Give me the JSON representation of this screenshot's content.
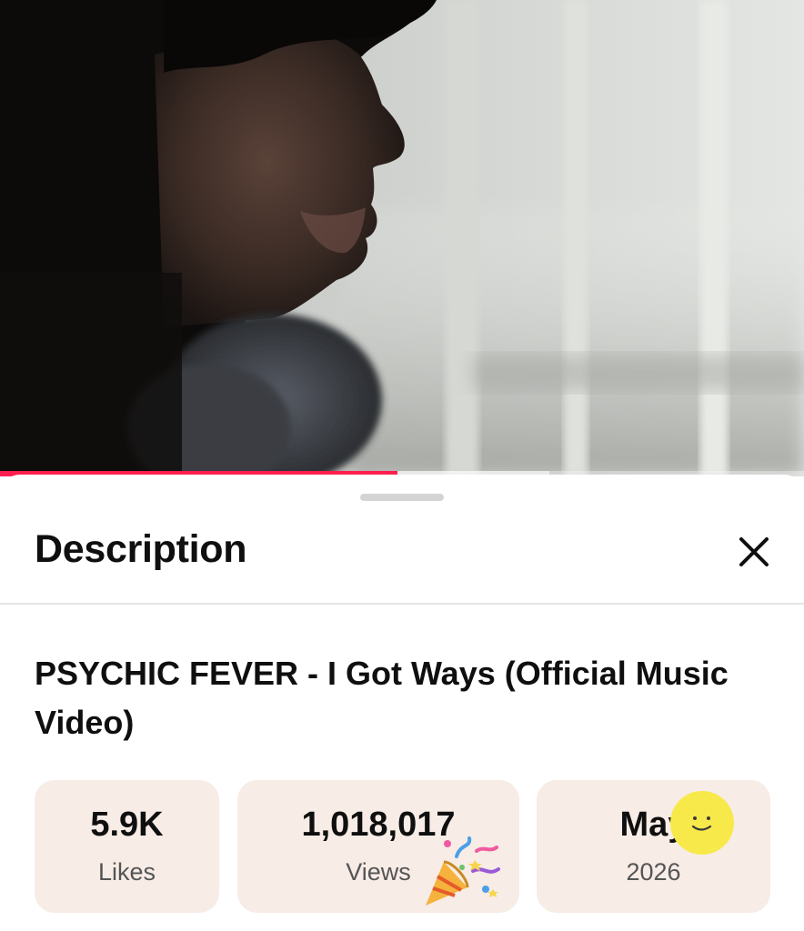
{
  "video": {
    "progress_fraction": 0.494,
    "buffered_fraction": 0.683,
    "accent_color": "#ff1f4f"
  },
  "sheet": {
    "title": "Description",
    "close_icon": "close-icon"
  },
  "description": {
    "video_title": "PSYCHIC FEVER - I Got Ways (Official Music Video)",
    "stats": [
      {
        "value": "5.9K",
        "label": "Likes"
      },
      {
        "value": "1,018,017",
        "label": "Views"
      },
      {
        "value": "May",
        "label": "2026"
      }
    ]
  },
  "icons": [
    "drag-handle",
    "close-icon",
    "smile-emoji-icon",
    "party-popper-emoji-icon"
  ]
}
